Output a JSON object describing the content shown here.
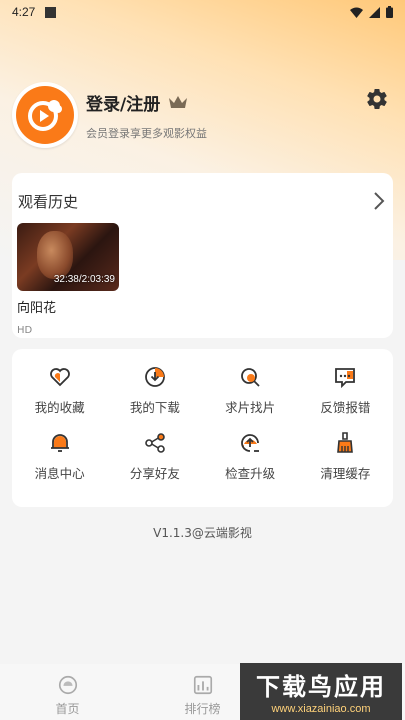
{
  "status": {
    "time": "4:27"
  },
  "profile": {
    "title": "登录/注册",
    "subtitle": "会员登录享更多观影权益"
  },
  "history": {
    "title": "观看历史",
    "items": [
      {
        "title": "向阳花",
        "progress": "32:38/2:03:39",
        "quality": "HD"
      }
    ]
  },
  "menu": [
    {
      "label": "我的收藏",
      "icon": "heart-icon"
    },
    {
      "label": "我的下载",
      "icon": "download-icon"
    },
    {
      "label": "求片找片",
      "icon": "search-film-icon"
    },
    {
      "label": "反馈报错",
      "icon": "feedback-icon"
    },
    {
      "label": "消息中心",
      "icon": "bell-icon"
    },
    {
      "label": "分享好友",
      "icon": "share-icon"
    },
    {
      "label": "检查升级",
      "icon": "upgrade-icon"
    },
    {
      "label": "清理缓存",
      "icon": "broom-icon"
    }
  ],
  "version": "V1.1.3@云端影视",
  "tabs": [
    {
      "label": "首页",
      "icon": "home-icon"
    },
    {
      "label": "排行榜",
      "icon": "ranking-icon"
    }
  ],
  "watermark": {
    "main": "下载鸟应用",
    "sub": "www.xiazainiao.com"
  },
  "colors": {
    "accent": "#fa7a18",
    "icon_dark": "#333333"
  }
}
